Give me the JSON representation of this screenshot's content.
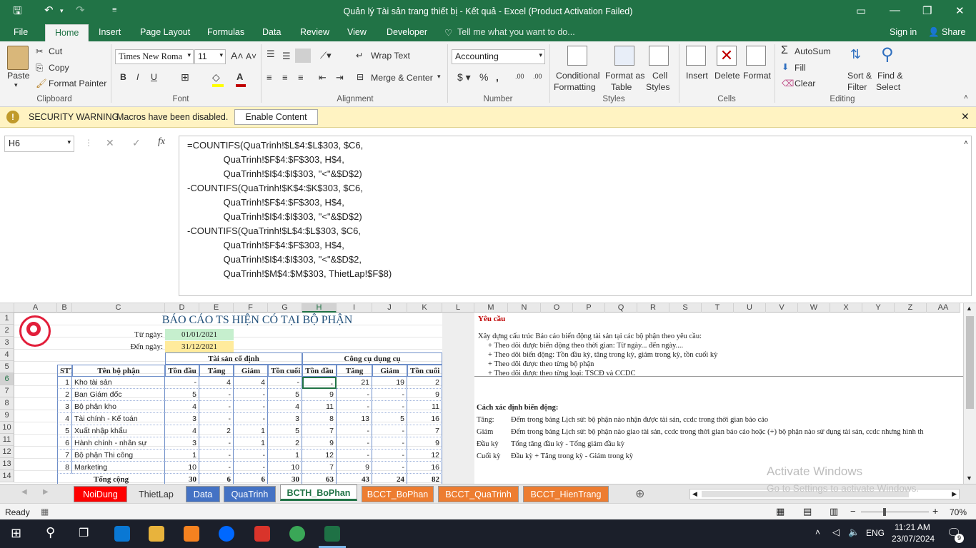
{
  "window": {
    "title": "Quản lý Tài sản trang thiết bị - Kết quả - Excel (Product Activation Failed)"
  },
  "ribbon_tabs": [
    "File",
    "Home",
    "Insert",
    "Page Layout",
    "Formulas",
    "Data",
    "Review",
    "View",
    "Developer"
  ],
  "tell_me": "Tell me what you want to do...",
  "sign_in": "Sign in",
  "share": "Share",
  "clipboard": {
    "paste": "Paste",
    "cut": "Cut",
    "copy": "Copy",
    "format_painter": "Format Painter",
    "label": "Clipboard"
  },
  "font": {
    "name": "Times New Roma",
    "size": "11",
    "label": "Font"
  },
  "alignment": {
    "wrap": "Wrap Text",
    "merge": "Merge & Center",
    "label": "Alignment"
  },
  "number": {
    "format": "Accounting",
    "label": "Number"
  },
  "styles": {
    "conditional": "Conditional",
    "formatting": "Formatting",
    "format_as": "Format as",
    "table": "Table",
    "cell": "Cell",
    "cell_styles": "Styles",
    "label": "Styles"
  },
  "cells": {
    "insert": "Insert",
    "delete": "Delete",
    "format": "Format",
    "label": "Cells"
  },
  "editing": {
    "autosum": "AutoSum",
    "fill": "Fill",
    "clear": "Clear",
    "sort": "Sort &",
    "filter": "Filter",
    "find": "Find &",
    "select": "Select",
    "label": "Editing"
  },
  "security": {
    "title": "SECURITY WARNING",
    "message": "Macros have been disabled.",
    "button": "Enable Content"
  },
  "namebox": "H6",
  "formula_lines": [
    "=COUNTIFS(QuaTrinh!$L$4:$L$303, $C6,",
    "              QuaTrinh!$F$4:$F$303, H$4,",
    "              QuaTrinh!$I$4:$I$303, \"<\"&$D$2)",
    "-COUNTIFS(QuaTrinh!$K$4:$K$303, $C6,",
    "              QuaTrinh!$F$4:$F$303, H$4,",
    "              QuaTrinh!$I$4:$I$303, \"<\"&$D$2)",
    "-COUNTIFS(QuaTrinh!$L$4:$L$303, $C6,",
    "              QuaTrinh!$F$4:$F$303, H$4,",
    "              QuaTrinh!$I$4:$I$303, \"<\"&$D$2,",
    "              QuaTrinh!$M$4:$M$303, ThietLap!$F$8)"
  ],
  "columns": [
    "A",
    "B",
    "C",
    "D",
    "E",
    "F",
    "G",
    "H",
    "I",
    "J",
    "K",
    "L",
    "M",
    "N",
    "O",
    "P",
    "Q",
    "R",
    "S",
    "T",
    "U",
    "V",
    "W",
    "X",
    "Y",
    "Z",
    "AA"
  ],
  "rows": [
    "1",
    "2",
    "3",
    "4",
    "5",
    "6",
    "7",
    "8",
    "9",
    "10",
    "11",
    "12",
    "13",
    "14"
  ],
  "report": {
    "title": "BÁO CÁO TS HIỆN CÓ TẠI BỘ PHẬN",
    "from_label": "Từ ngày:",
    "from_value": "01/01/2021",
    "to_label": "Đến ngày:",
    "to_value": "31/12/2021",
    "group1": "Tài sản cố định",
    "group2": "Công cụ dụng cụ",
    "headers": [
      "STT",
      "Tên bộ phận",
      "Tồn đầu",
      "Tăng",
      "Giảm",
      "Tồn cuối",
      "Tồn đầu",
      "Tăng",
      "Giảm",
      "Tồn cuối"
    ],
    "rows": [
      [
        "1",
        "Kho tài sản",
        "-",
        "4",
        "4",
        "-",
        "-",
        "21",
        "19",
        "2"
      ],
      [
        "2",
        "Ban Giám đốc",
        "5",
        "-",
        "-",
        "5",
        "9",
        "-",
        "-",
        "9"
      ],
      [
        "3",
        "Bộ phận kho",
        "4",
        "-",
        "-",
        "4",
        "11",
        "-",
        "-",
        "11"
      ],
      [
        "4",
        "Tài chính - Kế toán",
        "3",
        "-",
        "-",
        "3",
        "8",
        "13",
        "5",
        "16"
      ],
      [
        "5",
        "Xuất nhập khẩu",
        "4",
        "2",
        "1",
        "5",
        "7",
        "-",
        "-",
        "7"
      ],
      [
        "6",
        "Hành chính - nhân sự",
        "3",
        "-",
        "1",
        "2",
        "9",
        "-",
        "-",
        "9"
      ],
      [
        "7",
        "Bộ phận Thi công",
        "1",
        "-",
        "-",
        "1",
        "12",
        "-",
        "-",
        "12"
      ],
      [
        "8",
        "Marketing",
        "10",
        "-",
        "-",
        "10",
        "7",
        "9",
        "-",
        "16"
      ]
    ],
    "total": [
      "Tổng cộng",
      "30",
      "6",
      "6",
      "30",
      "63",
      "43",
      "24",
      "82"
    ]
  },
  "notes": {
    "req_title": "Yêu cầu",
    "req_lines": [
      "Xây dựng cấu trúc Báo cáo biến động tài sản tại các bộ phận theo yêu cầu:",
      "+ Theo dõi được biến động theo thời gian: Từ ngày... đến ngày....",
      "+ Theo dõi biến động: Tồn đầu kỳ, tăng trong kỳ, giảm trong kỳ, tồn cuối kỳ",
      "+ Theo dõi được theo từng bộ phận",
      "+ Theo dõi được theo từng loại: TSCĐ và CCDC"
    ],
    "method_title": "Cách xác định biến động:",
    "method": [
      {
        "k": "Tăng:",
        "v": "Đếm trong bảng Lịch sử: bộ phận nào nhận được tài sản, ccdc trong thời gian báo cáo"
      },
      {
        "k": "Giảm",
        "v": "Đếm trong bảng Lịch sử: bộ phận nào giao tài sản, ccdc trong thời gian báo cáo hoặc (+) bộ phận nào sử dụng tài sản, ccdc nhưng hình th"
      },
      {
        "k": "Đầu kỳ",
        "v": "Tổng tăng đầu kỳ - Tổng giảm đầu kỳ"
      },
      {
        "k": "Cuối kỳ",
        "v": "Đầu kỳ + Tăng trong kỳ - Giảm trong kỳ"
      }
    ]
  },
  "activation": {
    "line1": "Activate Windows",
    "line2": "Go to Settings to activate Windows."
  },
  "sheet_tabs": [
    {
      "name": "NoiDung",
      "color": "#ff0000"
    },
    {
      "name": "ThietLap",
      "color": "#e6e6e6"
    },
    {
      "name": "Data",
      "color": "#4472c4"
    },
    {
      "name": "QuaTrinh",
      "color": "#4472c4"
    },
    {
      "name": "BCTH_BoPhan",
      "color": "#ffffff"
    },
    {
      "name": "BCCT_BoPhan",
      "color": "#ed7d31"
    },
    {
      "name": "BCCT_QuaTrinh",
      "color": "#ed7d31"
    },
    {
      "name": "BCCT_HienTrang",
      "color": "#ed7d31"
    }
  ],
  "status": {
    "ready": "Ready",
    "zoom": "70%"
  },
  "taskbar": {
    "lang": "ENG",
    "time": "11:21 AM",
    "date": "23/07/2024",
    "notif": "9"
  }
}
